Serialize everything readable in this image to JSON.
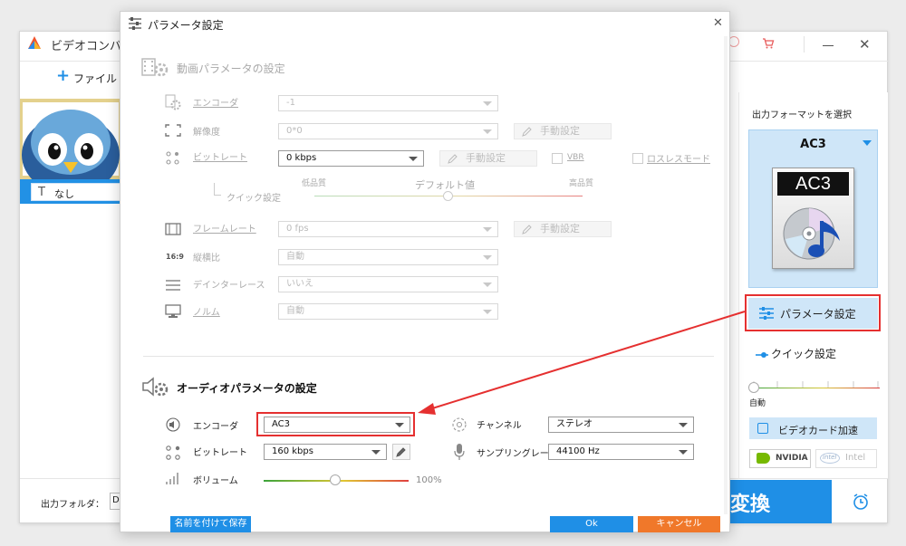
{
  "main_window": {
    "title": "ビデオコンバ",
    "add_file": "ファイル",
    "subtitle_label": "なし",
    "output_folder_label": "出力フォルダ：",
    "output_folder_value": "D",
    "convert_label": "変換"
  },
  "right_panel": {
    "format_header": "出力フォーマットを選択",
    "format_name": "AC3",
    "icon_text": "AC3",
    "param_button": "パラメータ設定",
    "quick_setting": "クイック設定",
    "quality_label": "自動",
    "quality_level": 0,
    "gpu_button": "ビデオカード加速",
    "nvidia": "NVIDIA",
    "intel": "intel",
    "intel_label": "Intel"
  },
  "dialog": {
    "title": "パラメータ設定",
    "video_section": "動画パラメータの設定",
    "encoder_label": "エンコーダ",
    "encoder_value": "-1",
    "resolution_label": "解像度",
    "resolution_value": "0*0",
    "manual": "手動設定",
    "bitrate_label": "ビットレート",
    "bitrate_value": "0 kbps",
    "vbr": "VBR",
    "lossless": "ロスレスモード",
    "quick_label": "クイック設定",
    "low_quality": "低品質",
    "default_value": "デフォルト値",
    "high_quality": "高品質",
    "framerate_label": "フレームレート",
    "framerate_value": "0 fps",
    "aspect_label": "縦横比",
    "aspect_icon": "16:9",
    "aspect_value": "自動",
    "deinterlace_label": "デインターレース",
    "deinterlace_value": "いいえ",
    "norm_label": "ノルム",
    "norm_value": "自動",
    "audio_section": "オーディオパラメータの設定",
    "a_encoder_label": "エンコーダ",
    "a_encoder_value": "AC3",
    "channel_label": "チャンネル",
    "channel_value": "ステレオ",
    "a_bitrate_label": "ビットレート",
    "a_bitrate_value": "160 kbps",
    "samplerate_label": "サンプリングレート",
    "samplerate_value": "44100 Hz",
    "volume_label": "ボリューム",
    "volume_value": "100%",
    "save_as": "名前を付けて保存",
    "ok": "Ok",
    "cancel": "キャンセル"
  },
  "colors": {
    "accent_blue": "#1f8fe6",
    "highlight_red": "#e53030",
    "cancel_orange": "#f0782a",
    "selected_blue": "#cfe6f8",
    "nvidia_green": "#76b900"
  }
}
